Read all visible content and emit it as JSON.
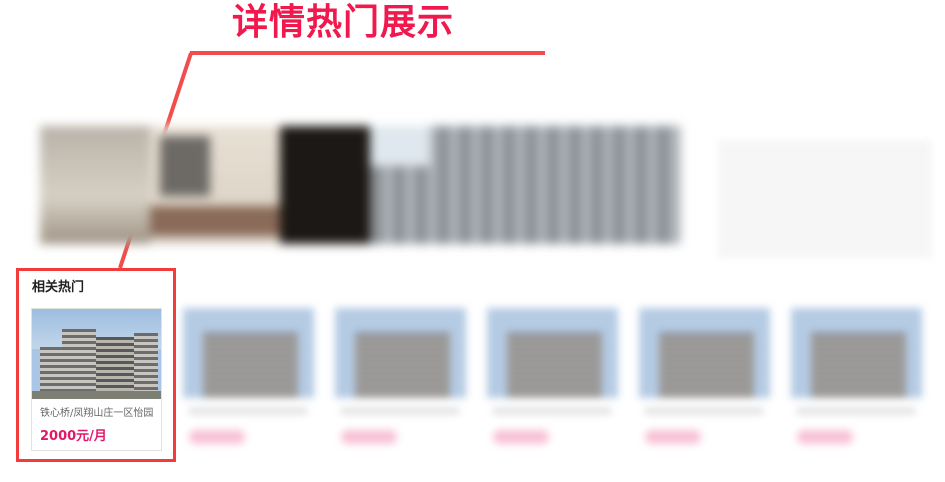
{
  "annotation": {
    "headline": "详情热门展示",
    "accent_color": "#f0184c",
    "box_color": "#f23c3c"
  },
  "section": {
    "title": "相关热门"
  },
  "cards": [
    {
      "address": "铁心桥/凤翔山庄一区怡园",
      "price": "2000元/月",
      "price_color": "#e0186a"
    }
  ]
}
